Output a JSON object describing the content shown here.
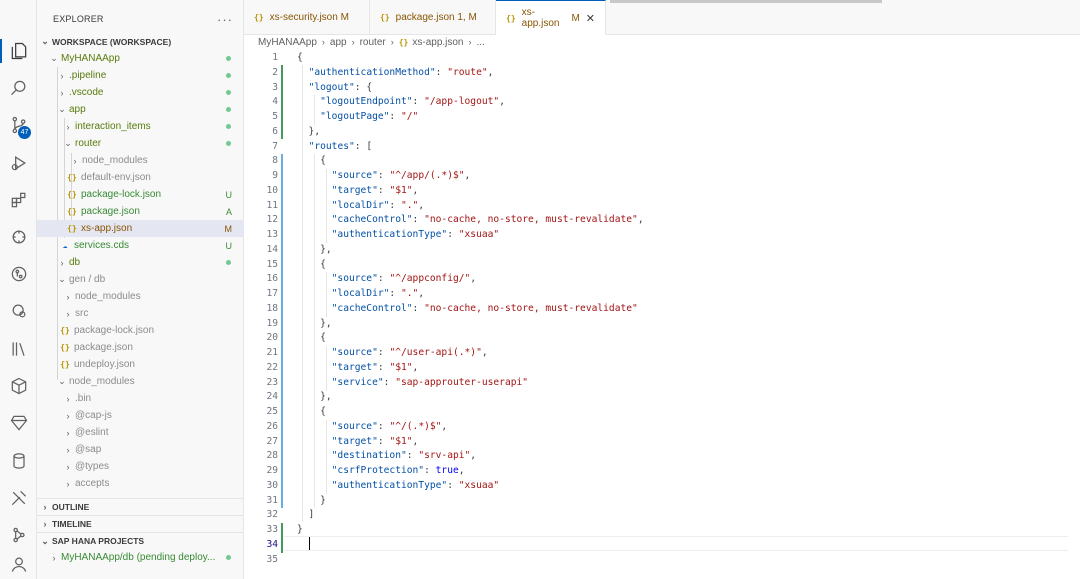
{
  "explorer": {
    "title": "EXPLORER",
    "more": "···",
    "workspace": "WORKSPACE (WORKSPACE)",
    "tree": [
      {
        "label": "MyHANAApp",
        "status": "",
        "dot": true
      },
      {
        "label": ".pipeline",
        "status": "",
        "dot": true
      },
      {
        "label": ".vscode",
        "status": "",
        "dot": true
      },
      {
        "label": "app",
        "status": "",
        "dot": true
      },
      {
        "label": "interaction_items",
        "status": "",
        "dot": true
      },
      {
        "label": "router",
        "status": "",
        "dot": true
      },
      {
        "label": "node_modules",
        "status": ""
      },
      {
        "label": "default-env.json",
        "status": ""
      },
      {
        "label": "package-lock.json",
        "status": "U"
      },
      {
        "label": "package.json",
        "status": "A"
      },
      {
        "label": "xs-app.json",
        "status": "M"
      },
      {
        "label": "services.cds",
        "status": "U"
      },
      {
        "label": "db",
        "status": "",
        "dot": true
      },
      {
        "label": "gen / db",
        "status": ""
      },
      {
        "label": "node_modules",
        "status": ""
      },
      {
        "label": "src",
        "status": ""
      },
      {
        "label": "package-lock.json",
        "status": ""
      },
      {
        "label": "package.json",
        "status": ""
      },
      {
        "label": "undeploy.json",
        "status": ""
      },
      {
        "label": "node_modules",
        "status": ""
      },
      {
        "label": ".bin",
        "status": ""
      },
      {
        "label": "@cap-js",
        "status": ""
      },
      {
        "label": "@eslint",
        "status": ""
      },
      {
        "label": "@sap",
        "status": ""
      },
      {
        "label": "@types",
        "status": ""
      },
      {
        "label": "accepts",
        "status": ""
      }
    ],
    "sections": [
      "OUTLINE",
      "TIMELINE",
      "SAP HANA PROJECTS"
    ],
    "hana_item": "MyHANAApp/db (pending deploy...",
    "scm_badge": "47"
  },
  "tabs": [
    {
      "icon": "{}",
      "label": "xs-security.json",
      "status": "M"
    },
    {
      "icon": "{}",
      "label": "package.json",
      "status": "1, M"
    },
    {
      "icon": "{}",
      "label": "xs-app.json",
      "status": "M",
      "close": "✕"
    }
  ],
  "breadcrumb": [
    "MyHANAApp",
    "app",
    "router",
    "xs-app.json",
    "..."
  ],
  "editor": {
    "lines": [
      [
        [
          "p",
          "{"
        ]
      ],
      [
        [
          "p",
          "  "
        ],
        [
          "k",
          "\"authenticationMethod\""
        ],
        [
          "p",
          ": "
        ],
        [
          "s",
          "\"route\""
        ],
        [
          "p",
          ","
        ]
      ],
      [
        [
          "p",
          "  "
        ],
        [
          "k",
          "\"logout\""
        ],
        [
          "p",
          ": {"
        ]
      ],
      [
        [
          "p",
          "    "
        ],
        [
          "k",
          "\"logoutEndpoint\""
        ],
        [
          "p",
          ": "
        ],
        [
          "s",
          "\"/app-logout\""
        ],
        [
          "p",
          ","
        ]
      ],
      [
        [
          "p",
          "    "
        ],
        [
          "k",
          "\"logoutPage\""
        ],
        [
          "p",
          ": "
        ],
        [
          "s",
          "\"/\""
        ]
      ],
      [
        [
          "p",
          "  },"
        ]
      ],
      [
        [
          "p",
          "  "
        ],
        [
          "k",
          "\"routes\""
        ],
        [
          "p",
          ": ["
        ]
      ],
      [
        [
          "p",
          "    {"
        ]
      ],
      [
        [
          "p",
          "      "
        ],
        [
          "k",
          "\"source\""
        ],
        [
          "p",
          ": "
        ],
        [
          "s",
          "\"^/app/(.*)$\""
        ],
        [
          "p",
          ","
        ]
      ],
      [
        [
          "p",
          "      "
        ],
        [
          "k",
          "\"target\""
        ],
        [
          "p",
          ": "
        ],
        [
          "s",
          "\"$1\""
        ],
        [
          "p",
          ","
        ]
      ],
      [
        [
          "p",
          "      "
        ],
        [
          "k",
          "\"localDir\""
        ],
        [
          "p",
          ": "
        ],
        [
          "s",
          "\".\""
        ],
        [
          "p",
          ","
        ]
      ],
      [
        [
          "p",
          "      "
        ],
        [
          "k",
          "\"cacheControl\""
        ],
        [
          "p",
          ": "
        ],
        [
          "s",
          "\"no-cache, no-store, must-revalidate\""
        ],
        [
          "p",
          ","
        ]
      ],
      [
        [
          "p",
          "      "
        ],
        [
          "k",
          "\"authenticationType\""
        ],
        [
          "p",
          ": "
        ],
        [
          "s",
          "\"xsuaa\""
        ]
      ],
      [
        [
          "p",
          "    },"
        ]
      ],
      [
        [
          "p",
          "    {"
        ]
      ],
      [
        [
          "p",
          "      "
        ],
        [
          "k",
          "\"source\""
        ],
        [
          "p",
          ": "
        ],
        [
          "s",
          "\"^/appconfig/\""
        ],
        [
          "p",
          ","
        ]
      ],
      [
        [
          "p",
          "      "
        ],
        [
          "k",
          "\"localDir\""
        ],
        [
          "p",
          ": "
        ],
        [
          "s",
          "\".\""
        ],
        [
          "p",
          ","
        ]
      ],
      [
        [
          "p",
          "      "
        ],
        [
          "k",
          "\"cacheControl\""
        ],
        [
          "p",
          ": "
        ],
        [
          "s",
          "\"no-cache, no-store, must-revalidate\""
        ]
      ],
      [
        [
          "p",
          "    },"
        ]
      ],
      [
        [
          "p",
          "    {"
        ]
      ],
      [
        [
          "p",
          "      "
        ],
        [
          "k",
          "\"source\""
        ],
        [
          "p",
          ": "
        ],
        [
          "s",
          "\"^/user-api(.*)\""
        ],
        [
          "p",
          ","
        ]
      ],
      [
        [
          "p",
          "      "
        ],
        [
          "k",
          "\"target\""
        ],
        [
          "p",
          ": "
        ],
        [
          "s",
          "\"$1\""
        ],
        [
          "p",
          ","
        ]
      ],
      [
        [
          "p",
          "      "
        ],
        [
          "k",
          "\"service\""
        ],
        [
          "p",
          ": "
        ],
        [
          "s",
          "\"sap-approuter-userapi\""
        ]
      ],
      [
        [
          "p",
          "    },"
        ]
      ],
      [
        [
          "p",
          "    {"
        ]
      ],
      [
        [
          "p",
          "      "
        ],
        [
          "k",
          "\"source\""
        ],
        [
          "p",
          ": "
        ],
        [
          "s",
          "\"^/(.*)$\""
        ],
        [
          "p",
          ","
        ]
      ],
      [
        [
          "p",
          "      "
        ],
        [
          "k",
          "\"target\""
        ],
        [
          "p",
          ": "
        ],
        [
          "s",
          "\"$1\""
        ],
        [
          "p",
          ","
        ]
      ],
      [
        [
          "p",
          "      "
        ],
        [
          "k",
          "\"destination\""
        ],
        [
          "p",
          ": "
        ],
        [
          "s",
          "\"srv-api\""
        ],
        [
          "p",
          ","
        ]
      ],
      [
        [
          "p",
          "      "
        ],
        [
          "k",
          "\"csrfProtection\""
        ],
        [
          "p",
          ": "
        ],
        [
          "b",
          "true"
        ],
        [
          "p",
          ","
        ]
      ],
      [
        [
          "p",
          "      "
        ],
        [
          "k",
          "\"authenticationType\""
        ],
        [
          "p",
          ": "
        ],
        [
          "s",
          "\"xsuaa\""
        ]
      ],
      [
        [
          "p",
          "    }"
        ]
      ],
      [
        [
          "p",
          "  ]"
        ]
      ],
      [
        [
          "p",
          "}"
        ]
      ],
      [
        [
          "p",
          ""
        ]
      ],
      [
        [
          "p",
          ""
        ]
      ]
    ]
  },
  "colors": {
    "accent": "#005fb8",
    "modified": "#895503",
    "untracked": "#388a34",
    "json_key": "#0451a5",
    "json_string": "#a31515"
  }
}
